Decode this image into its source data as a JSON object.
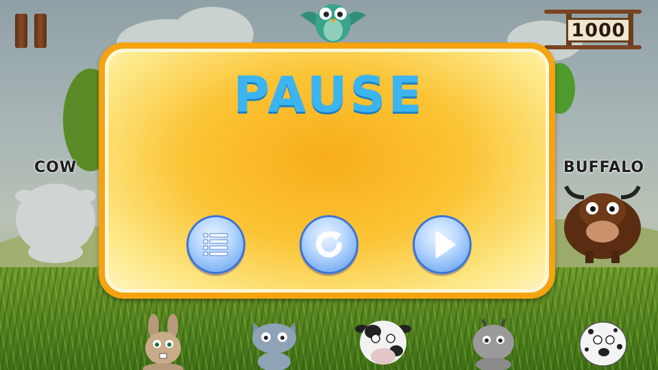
{
  "game": {
    "score": "1000",
    "pause_title": "PAUSE",
    "target_label_left": "COW",
    "target_label_right": "BUFFALO"
  },
  "buttons": {
    "menu": "menu-list-icon",
    "restart": "restart-icon",
    "resume": "play-icon"
  },
  "colors": {
    "panel_border": "#f5a311",
    "title": "#3cb4f0",
    "button_fill": "#a9ccff",
    "button_border": "#3f72d6"
  }
}
